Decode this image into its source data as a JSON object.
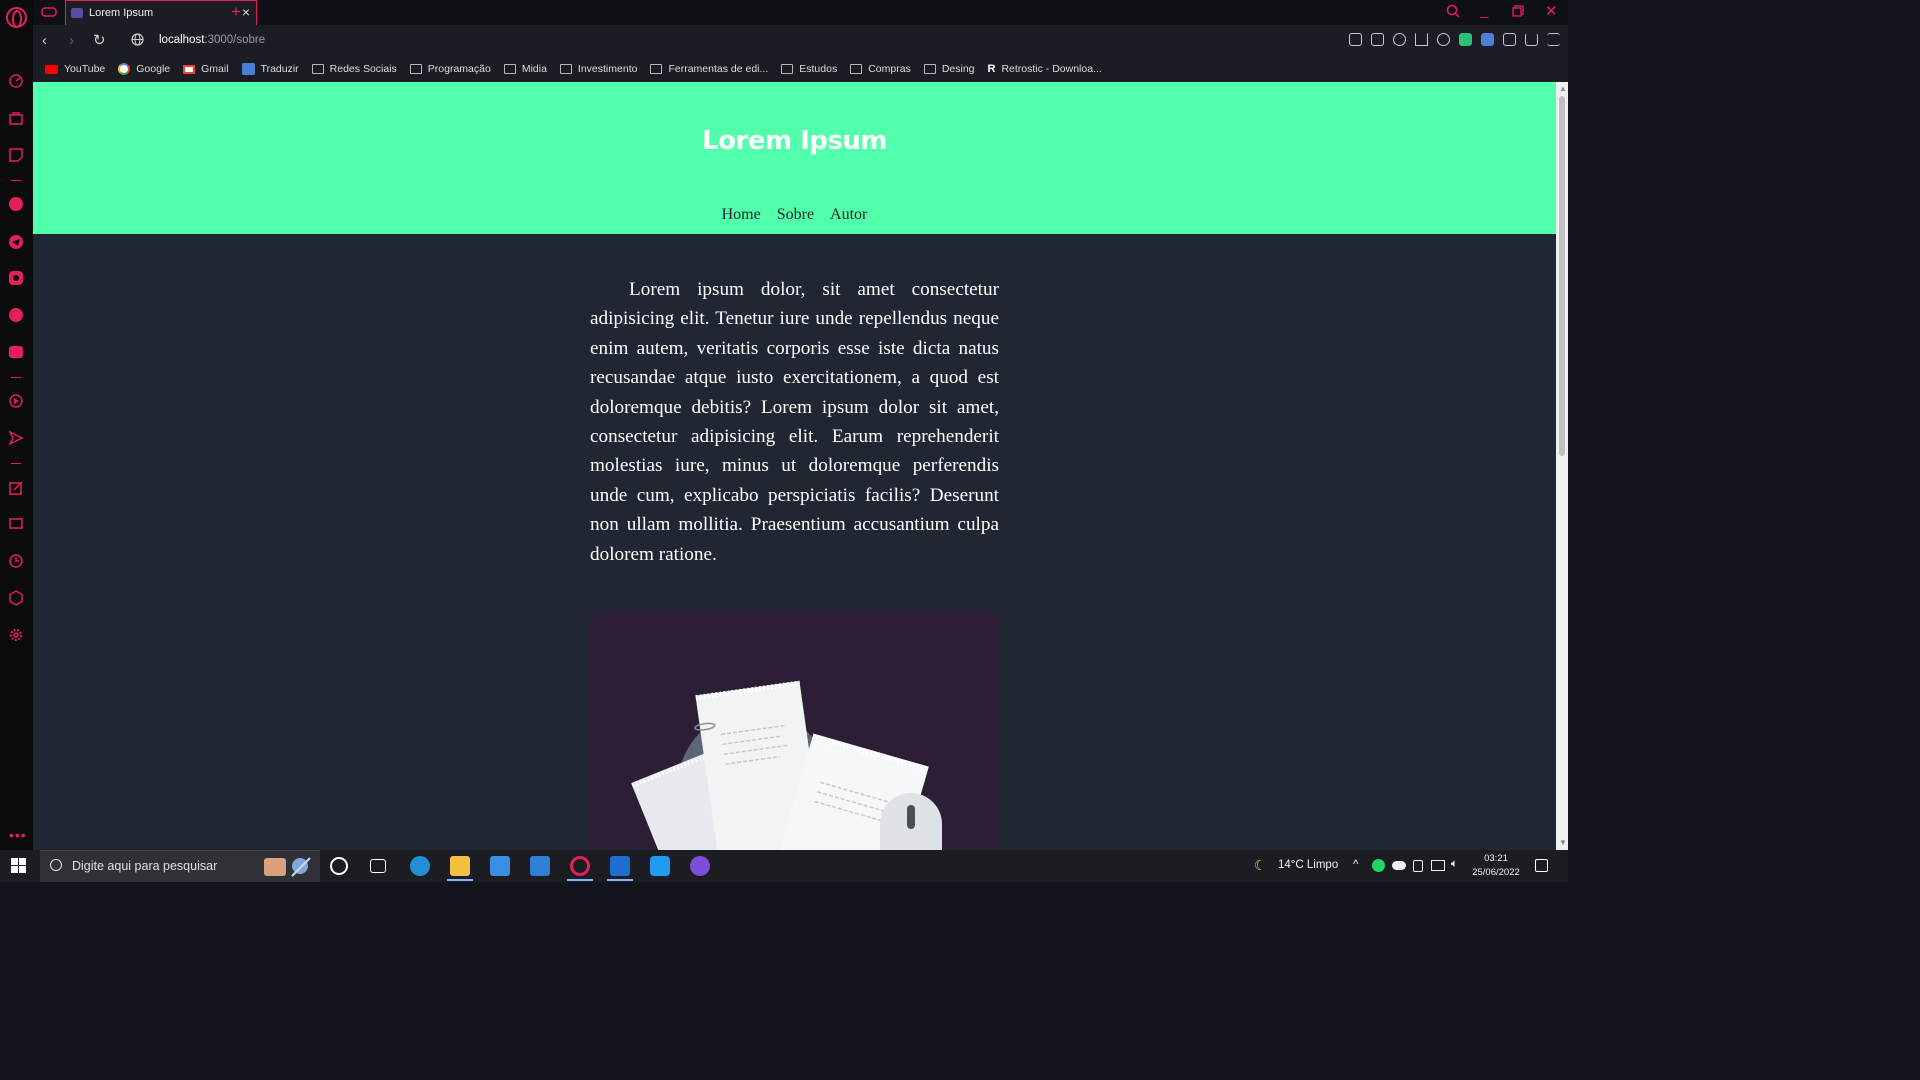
{
  "browser": {
    "tab_title": "Lorem Ipsum",
    "url_host": "localhost",
    "url_rest": ":3000/sobre",
    "bookmarks": [
      {
        "label": "YouTube",
        "icon": "youtube-icon"
      },
      {
        "label": "Google",
        "icon": "google-icon"
      },
      {
        "label": "Gmail",
        "icon": "gmail-icon"
      },
      {
        "label": "Traduzir",
        "icon": "translate-icon"
      },
      {
        "label": "Redes Sociais",
        "icon": "folder-icon"
      },
      {
        "label": "Programação",
        "icon": "folder-icon"
      },
      {
        "label": "Midia",
        "icon": "folder-icon"
      },
      {
        "label": "Investimento",
        "icon": "folder-icon"
      },
      {
        "label": "Ferramentas de edi...",
        "icon": "folder-icon"
      },
      {
        "label": "Estudos",
        "icon": "folder-icon"
      },
      {
        "label": "Compras",
        "icon": "folder-icon"
      },
      {
        "label": "Desing",
        "icon": "folder-icon"
      },
      {
        "label": "Retrostic - Downloa...",
        "icon": "retrostic-icon"
      }
    ],
    "accent": "#e3205a"
  },
  "page": {
    "site_title": "Lorem Ipsum",
    "nav": [
      "Home",
      "Sobre",
      "Autor"
    ],
    "article": "Lorem ipsum dolor, sit amet consectetur adipisicing elit. Tenetur iure unde repellendus neque enim autem, veritatis corporis esse iste dicta natus recusandae atque iusto exercitationem, a quod est doloremque debitis? Lorem ipsum dolor sit amet, consectetur adipisicing elit. Earum reprehenderit molestias iure, minus ut doloremque perferendis unde cum, explicabo perspiciatis facilis? Deserunt non ullam mollitia. Praesentium accusantium culpa dolorem ratione.",
    "header_color": "#52ffaa",
    "background_color": "#202632"
  },
  "taskbar": {
    "search_placeholder": "Digite aqui para pesquisar",
    "weather": "14°C  Limpo",
    "time": "03:21",
    "date": "25/06/2022"
  }
}
